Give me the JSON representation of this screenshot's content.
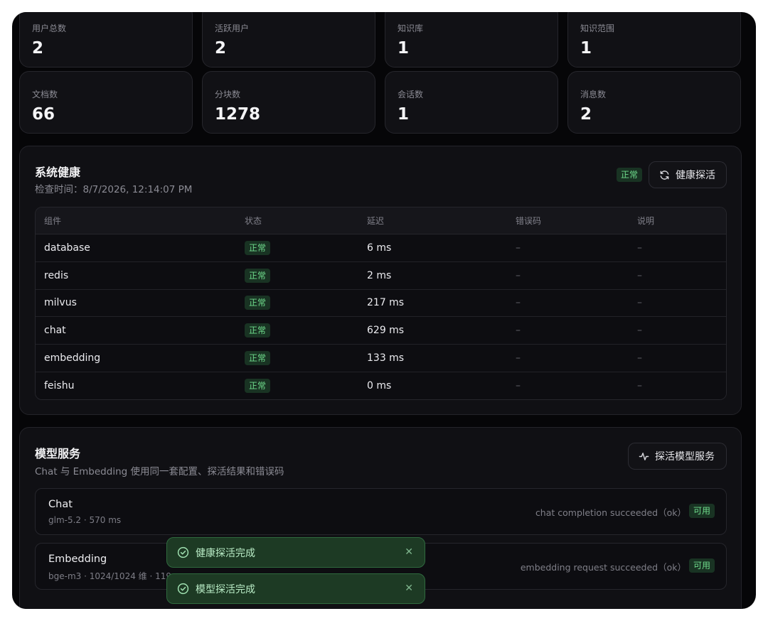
{
  "stats_row1": [
    {
      "label": "用户总数",
      "value": "2"
    },
    {
      "label": "活跃用户",
      "value": "2"
    },
    {
      "label": "知识库",
      "value": "1"
    },
    {
      "label": "知识范围",
      "value": "1"
    }
  ],
  "stats_row2": [
    {
      "label": "文档数",
      "value": "66"
    },
    {
      "label": "分块数",
      "value": "1278"
    },
    {
      "label": "会话数",
      "value": "1"
    },
    {
      "label": "消息数",
      "value": "2"
    }
  ],
  "health": {
    "title": "系统健康",
    "checked_at": "检查时间：8/7/2026, 12:14:07 PM",
    "overall_status": "正常",
    "probe_button": "健康探活",
    "columns": [
      "组件",
      "状态",
      "延迟",
      "错误码",
      "说明"
    ],
    "rows": [
      {
        "component": "database",
        "status": "正常",
        "latency": "6 ms",
        "error": "–",
        "note": "–"
      },
      {
        "component": "redis",
        "status": "正常",
        "latency": "2 ms",
        "error": "–",
        "note": "–"
      },
      {
        "component": "milvus",
        "status": "正常",
        "latency": "217 ms",
        "error": "–",
        "note": "–"
      },
      {
        "component": "chat",
        "status": "正常",
        "latency": "629 ms",
        "error": "–",
        "note": "–"
      },
      {
        "component": "embedding",
        "status": "正常",
        "latency": "133 ms",
        "error": "–",
        "note": "–"
      },
      {
        "component": "feishu",
        "status": "正常",
        "latency": "0 ms",
        "error": "–",
        "note": "–"
      }
    ]
  },
  "models": {
    "title": "模型服务",
    "subtitle": "Chat 与 Embedding 使用同一套配置、探活结果和错误码",
    "probe_button": "探活模型服务",
    "items": [
      {
        "name": "Chat",
        "meta": "glm-5.2 · 570 ms",
        "status_text": "chat completion succeeded（ok）",
        "badge": "可用"
      },
      {
        "name": "Embedding",
        "meta": "bge-m3 · 1024/1024 维 · 119 ms",
        "status_text": "embedding request succeeded（ok）",
        "badge": "可用"
      }
    ]
  },
  "toasts": [
    {
      "message": "健康探活完成",
      "close": "✕"
    },
    {
      "message": "模型探活完成",
      "close": "✕"
    }
  ],
  "colors": {
    "accent_green": "#6fdc8c",
    "toast_bg": "#1d3a24",
    "background": "#060608"
  }
}
